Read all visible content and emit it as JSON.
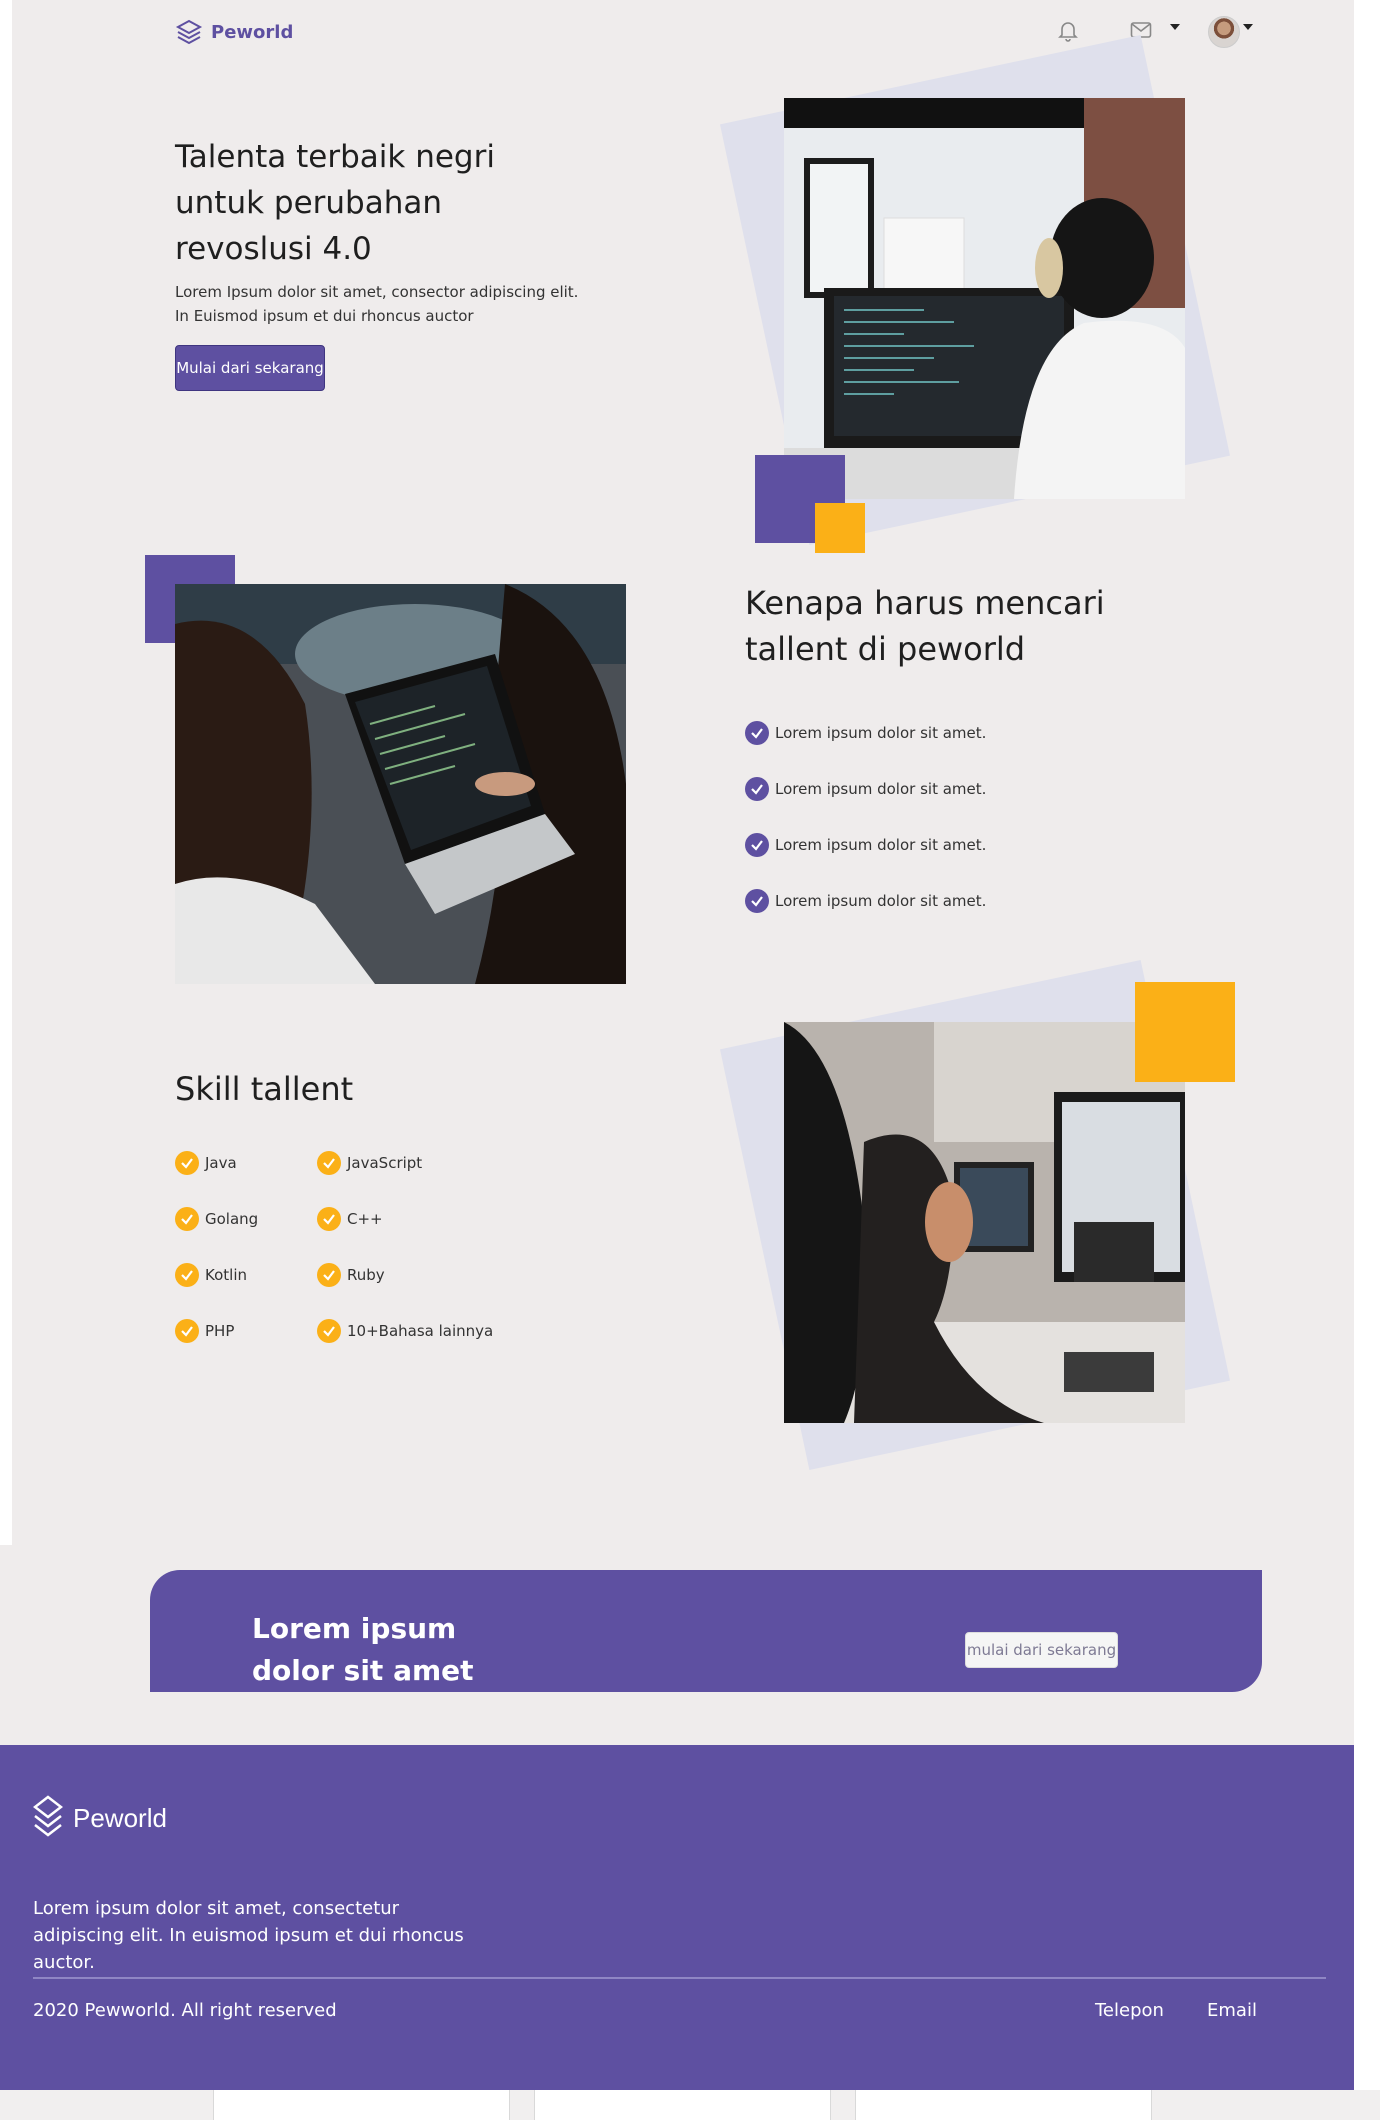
{
  "nav": {
    "brand": "Peworld"
  },
  "hero": {
    "title": "Talenta terbaik negri untuk perubahan revoslusi 4.0",
    "subtitle": "Lorem Ipsum dolor sit amet, consector adipiscing elit. In Euismod ipsum et dui rhoncus auctor",
    "cta_label": "Mulai dari sekarang"
  },
  "why": {
    "title": "Kenapa harus mencari tallent di peworld",
    "items": [
      "Lorem ipsum dolor sit amet.",
      "Lorem ipsum dolor sit amet.",
      "Lorem ipsum dolor sit amet.",
      "Lorem ipsum dolor sit amet."
    ]
  },
  "skill": {
    "title": "Skill tallent",
    "items": [
      "Java",
      "JavaScript",
      "Golang",
      "C++",
      "Kotlin",
      "Ruby",
      "PHP",
      "10+Bahasa lainnya"
    ]
  },
  "cta": {
    "title": "Lorem ipsum dolor sit amet",
    "button_label": "mulai dari sekarang"
  },
  "footer": {
    "brand": "Peworld",
    "description": "Lorem ipsum dolor sit amet, consectetur adipiscing elit. In euismod ipsum et dui rhoncus auctor.",
    "copyright": "2020 Pewworld. All right reserved",
    "links": [
      "Telepon",
      "Email"
    ]
  },
  "colors": {
    "primary": "#5e50a1",
    "accent": "#fbb017",
    "background": "#efecec"
  }
}
